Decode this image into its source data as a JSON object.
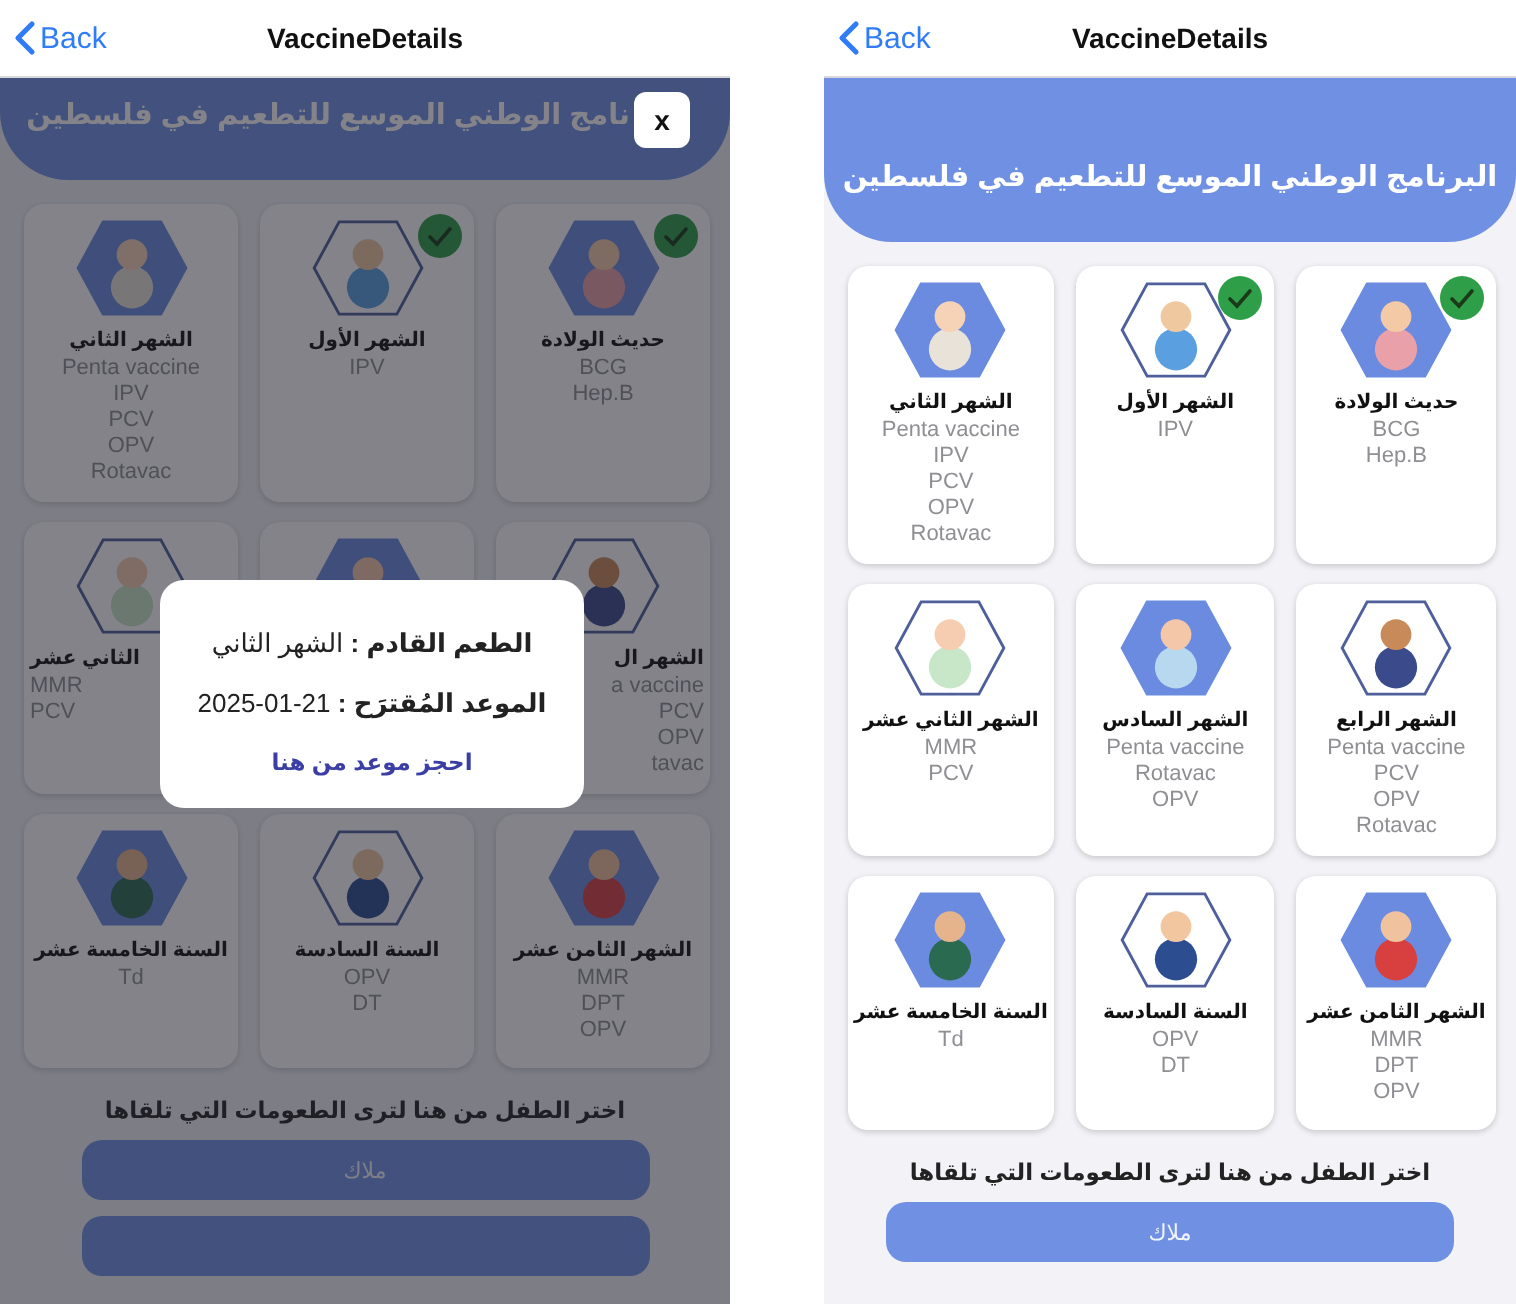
{
  "dialog_screen": {
    "nav": {
      "back": "Back",
      "title": "VaccineDetails"
    },
    "scrolled": true,
    "banner": {
      "title": "نامج الوطني الموسع للتطعيم في فلسطين"
    },
    "cards": [
      {
        "title": "حديث الولادة",
        "vaccines": [
          "BCG",
          "Hep.B"
        ],
        "done": true,
        "hex_filled": true
      },
      {
        "title": "الشهر الأول",
        "vaccines": [
          "IPV"
        ],
        "done": true,
        "hex_filled": false
      },
      {
        "title": "الشهر الثاني",
        "vaccines": [
          "Penta vaccine",
          "IPV",
          "PCV",
          "OPV",
          "Rotavac"
        ],
        "done": false,
        "hex_filled": true
      },
      {
        "title": "الشهر ال",
        "vaccines": [
          "a vaccine",
          "PCV",
          "OPV",
          "tavac"
        ],
        "done": false,
        "hex_filled": false
      },
      {
        "done": false,
        "hex_filled": true
      },
      {
        "title": "الثاني عشر",
        "vaccines": [
          "MMR",
          "PCV"
        ],
        "done": false,
        "hex_filled": false
      },
      {
        "title": "الشهر الثامن عشر",
        "vaccines": [
          "MMR",
          "DPT",
          "OPV"
        ],
        "done": false,
        "hex_filled": true
      },
      {
        "title": "السنة السادسة",
        "vaccines": [
          "OPV",
          "DT"
        ],
        "done": false,
        "hex_filled": false
      },
      {
        "title": "السنة الخامسة عشر",
        "vaccines": [
          "Td"
        ],
        "done": false,
        "hex_filled": true
      }
    ],
    "prompt": "اختر الطفل من هنا لترى الطعومات التي تلقاها",
    "buttons": [
      {
        "kind": "child",
        "label": "ملاك"
      },
      {
        "kind": "child"
      }
    ],
    "modal": {
      "close": "x",
      "lines": [
        {
          "label": "الطعم القادم :",
          "value": "الشهر الثاني"
        },
        {
          "label": "الموعد المُقترَح :",
          "value": "2025-01-21"
        }
      ],
      "link": "احجز موعد من هنا"
    }
  },
  "list_screen": {
    "nav": {
      "back": "Back",
      "title": "VaccineDetails"
    },
    "scrolled": false,
    "banner": {
      "title": "البرنامج الوطني الموسع للتطعيم في فلسطين"
    },
    "cards": [
      {
        "title": "حديث الولادة",
        "vaccines": [
          "BCG",
          "Hep.B"
        ],
        "done": true,
        "hex_filled": true
      },
      {
        "title": "الشهر الأول",
        "vaccines": [
          "IPV"
        ],
        "done": true,
        "hex_filled": false
      },
      {
        "title": "الشهر الثاني",
        "vaccines": [
          "Penta vaccine",
          "IPV",
          "PCV",
          "OPV",
          "Rotavac"
        ],
        "done": false,
        "hex_filled": true
      },
      {
        "title": "الشهر الرابع",
        "vaccines": [
          "Penta vaccine",
          "PCV",
          "OPV",
          "Rotavac"
        ],
        "done": false,
        "hex_filled": false
      },
      {
        "title": "الشهر السادس",
        "vaccines": [
          "Penta vaccine",
          "Rotavac",
          "OPV"
        ],
        "done": false,
        "hex_filled": true
      },
      {
        "title": "الشهر الثاني عشر",
        "vaccines": [
          "MMR",
          "PCV"
        ],
        "done": false,
        "hex_filled": false
      },
      {
        "title": "الشهر الثامن عشر",
        "vaccines": [
          "MMR",
          "DPT",
          "OPV"
        ],
        "done": false,
        "hex_filled": true
      },
      {
        "title": "السنة السادسة",
        "vaccines": [
          "OPV",
          "DT"
        ],
        "done": false,
        "hex_filled": false
      },
      {
        "title": "السنة الخامسة عشر",
        "vaccines": [
          "Td"
        ],
        "done": false,
        "hex_filled": true
      }
    ],
    "prompt": "اختر الطفل من هنا لترى الطعومات التي تلقاها",
    "buttons": [
      {
        "kind": "child",
        "label": "ملاك"
      }
    ]
  }
}
